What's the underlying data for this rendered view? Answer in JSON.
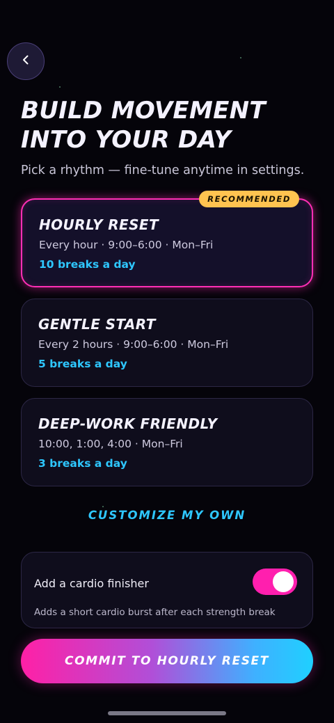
{
  "header": {
    "back_icon": "chevron-left-icon",
    "title_line1": "BUILD MOVEMENT",
    "title_line2": "INTO YOUR DAY",
    "subtitle": "Pick a rhythm — fine-tune anytime in settings."
  },
  "plans": [
    {
      "name": "HOURLY RESET",
      "detail": "Every hour · 9:00–6:00 · Mon–Fri",
      "breaks": "10 breaks a day",
      "badge": "RECOMMENDED",
      "selected": true
    },
    {
      "name": "GENTLE START",
      "detail": "Every 2 hours · 9:00–6:00 · Mon–Fri",
      "breaks": "5 breaks a day",
      "selected": false
    },
    {
      "name": "DEEP-WORK FRIENDLY",
      "detail": "10:00, 1:00, 4:00 · Mon–Fri",
      "breaks": "3 breaks a day",
      "selected": false
    }
  ],
  "customize_label": "CUSTOMIZE MY OWN",
  "cardio": {
    "label": "Add a cardio finisher",
    "description": "Adds a short cardio burst after each strength break",
    "enabled": true
  },
  "commit_label": "COMMIT TO HOURLY RESET",
  "colors": {
    "accent_pink": "#ff2fb5",
    "accent_cyan": "#2ec7ff",
    "badge_yellow": "#ffc350",
    "background": "#05040a"
  }
}
